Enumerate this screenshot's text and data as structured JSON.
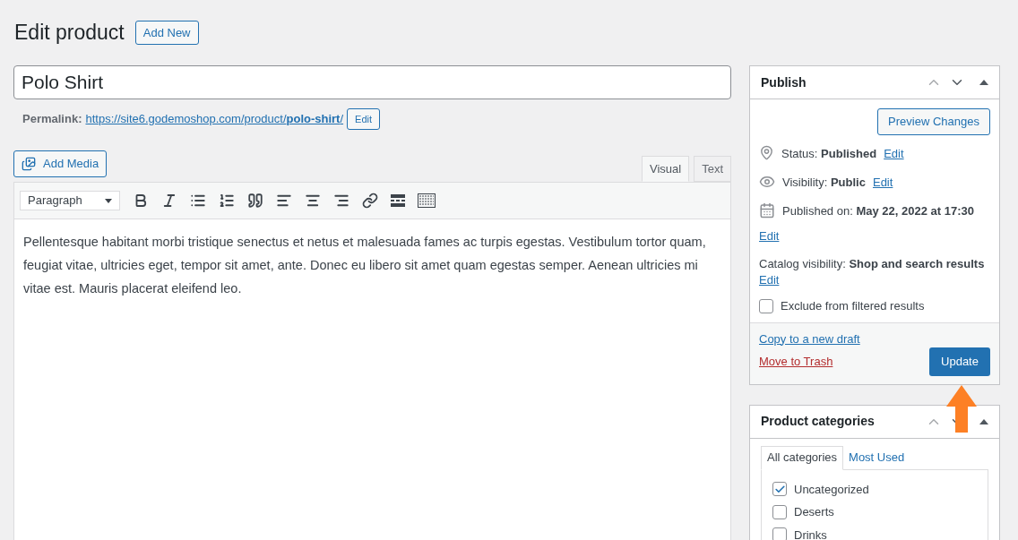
{
  "header": {
    "title": "Edit product",
    "add_new": "Add New"
  },
  "title_field": {
    "value": "Polo Shirt"
  },
  "permalink": {
    "label": "Permalink:",
    "url_base": "https://site6.godemoshop.com/product/",
    "url_slug": "polo-shirt",
    "url_end": "/",
    "edit": "Edit"
  },
  "add_media": "Add Media",
  "editor_tabs": [
    {
      "label": "Visual",
      "selected": true
    },
    {
      "label": "Text",
      "selected": false
    }
  ],
  "format_select": "Paragraph",
  "content": "Pellentesque habitant morbi tristique senectus et netus et malesuada fames ac turpis egestas. Vestibulum tortor quam, feugiat vitae, ultricies eget, tempor sit amet, ante. Donec eu libero sit amet quam egestas semper. Aenean ultricies mi vitae est. Mauris placerat eleifend leo.",
  "publish": {
    "title": "Publish",
    "preview": "Preview Changes",
    "rows": [
      {
        "kind": "status",
        "text": "Status: **Published**",
        "edit": "Edit"
      },
      {
        "kind": "visibility",
        "text": "Visibility: **Public**",
        "edit": "Edit"
      },
      {
        "kind": "date",
        "text": "Published on: **May 22, 2022 at 17:30**",
        "edit": "Edit"
      },
      {
        "kind": "catalog",
        "text": "Catalog visibility: **Shop and search results**",
        "edit": "Edit"
      }
    ],
    "exclude": {
      "label": "Exclude from filtered results",
      "checked": false
    },
    "copy": "Copy to a new draft",
    "trash": "Move to Trash",
    "update": "Update"
  },
  "categories": {
    "title": "Product categories",
    "tabs": [
      {
        "label": "All categories",
        "selected": true
      },
      {
        "label": "Most Used",
        "selected": false
      }
    ],
    "items": [
      {
        "label": "Uncategorized",
        "checked": true
      },
      {
        "label": "Deserts",
        "checked": false
      },
      {
        "label": "Drinks",
        "checked": false
      }
    ]
  }
}
